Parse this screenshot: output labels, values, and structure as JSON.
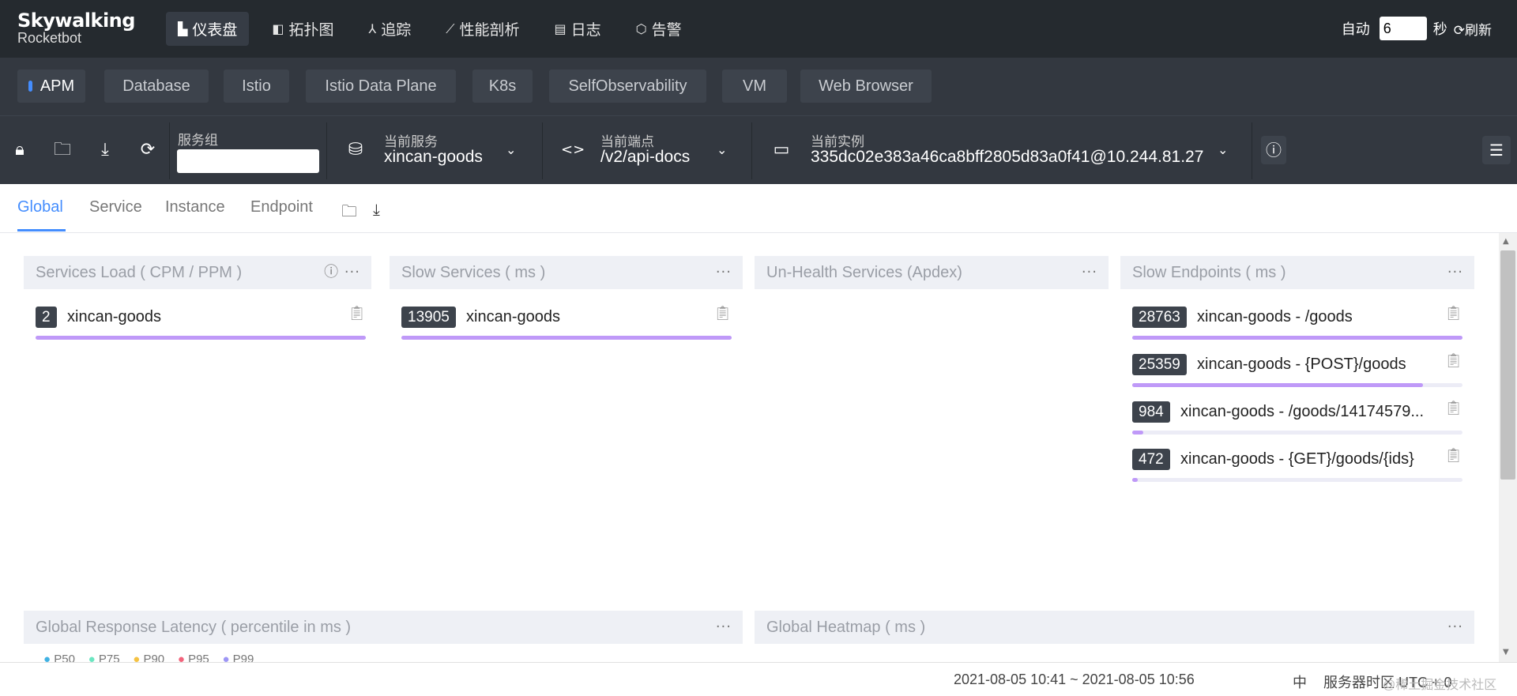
{
  "logo": {
    "line1": "Skywalking",
    "line2": "Rocketbot"
  },
  "nav": [
    {
      "label": "仪表盘",
      "icon": "chart-icon",
      "glyph": "▙",
      "active": true
    },
    {
      "label": "拓扑图",
      "icon": "topology-icon",
      "glyph": "◧",
      "active": false
    },
    {
      "label": "追踪",
      "icon": "trace-icon",
      "glyph": "⅄",
      "active": false
    },
    {
      "label": "性能剖析",
      "icon": "profile-icon",
      "glyph": "⟋",
      "active": false
    },
    {
      "label": "日志",
      "icon": "log-icon",
      "glyph": "▤",
      "active": false
    },
    {
      "label": "告警",
      "icon": "alarm-icon",
      "glyph": "⬡",
      "active": false
    }
  ],
  "auto_refresh": {
    "label": "自动",
    "interval": "6",
    "unit": "秒",
    "refresh_label": "刷新"
  },
  "layers": [
    "APM",
    "Database",
    "Istio",
    "Istio Data Plane",
    "K8s",
    "SelfObservability",
    "VM",
    "Web Browser"
  ],
  "selectors": {
    "group_label": "服务组",
    "group_value": "",
    "service_label": "当前服务",
    "service_value": "xincan-goods",
    "endpoint_label": "当前端点",
    "endpoint_value": "/v2/api-docs",
    "instance_label": "当前实例",
    "instance_value": "335dc02e383a46ca8bff2805d83a0f41@10.244.81.27"
  },
  "tabs": [
    "Global",
    "Service",
    "Instance",
    "Endpoint"
  ],
  "panels": {
    "services_load": {
      "title": "Services Load ( CPM / PPM )",
      "items": [
        {
          "value": "2",
          "name": "xincan-goods",
          "fill": 1.0
        }
      ]
    },
    "slow_services": {
      "title": "Slow Services ( ms )",
      "items": [
        {
          "value": "13905",
          "name": "xincan-goods",
          "fill": 1.0
        }
      ]
    },
    "unhealth_services": {
      "title": "Un-Health Services (Apdex)"
    },
    "slow_endpoints": {
      "title": "Slow Endpoints ( ms )",
      "items": [
        {
          "value": "28763",
          "name": "xincan-goods - /goods",
          "fill": 1.0
        },
        {
          "value": "25359",
          "name": "xincan-goods - {POST}/goods",
          "fill": 0.88
        },
        {
          "value": "984",
          "name": "xincan-goods - /goods/14174579...",
          "fill": 0.034
        },
        {
          "value": "472",
          "name": "xincan-goods - {GET}/goods/{ids}",
          "fill": 0.016
        }
      ]
    },
    "global_latency": {
      "title": "Global Response Latency ( percentile in ms )"
    },
    "global_heatmap": {
      "title": "Global Heatmap ( ms )"
    }
  },
  "legend": [
    "P50",
    "P75",
    "P90",
    "P95",
    "P99"
  ],
  "footer": {
    "time_range": "2021-08-05 10:41 ~ 2021-08-05 10:56",
    "lang": "中",
    "timezone": "服务器时区 UTC + 0",
    "watermark": "@稀土掘金技术社区"
  }
}
